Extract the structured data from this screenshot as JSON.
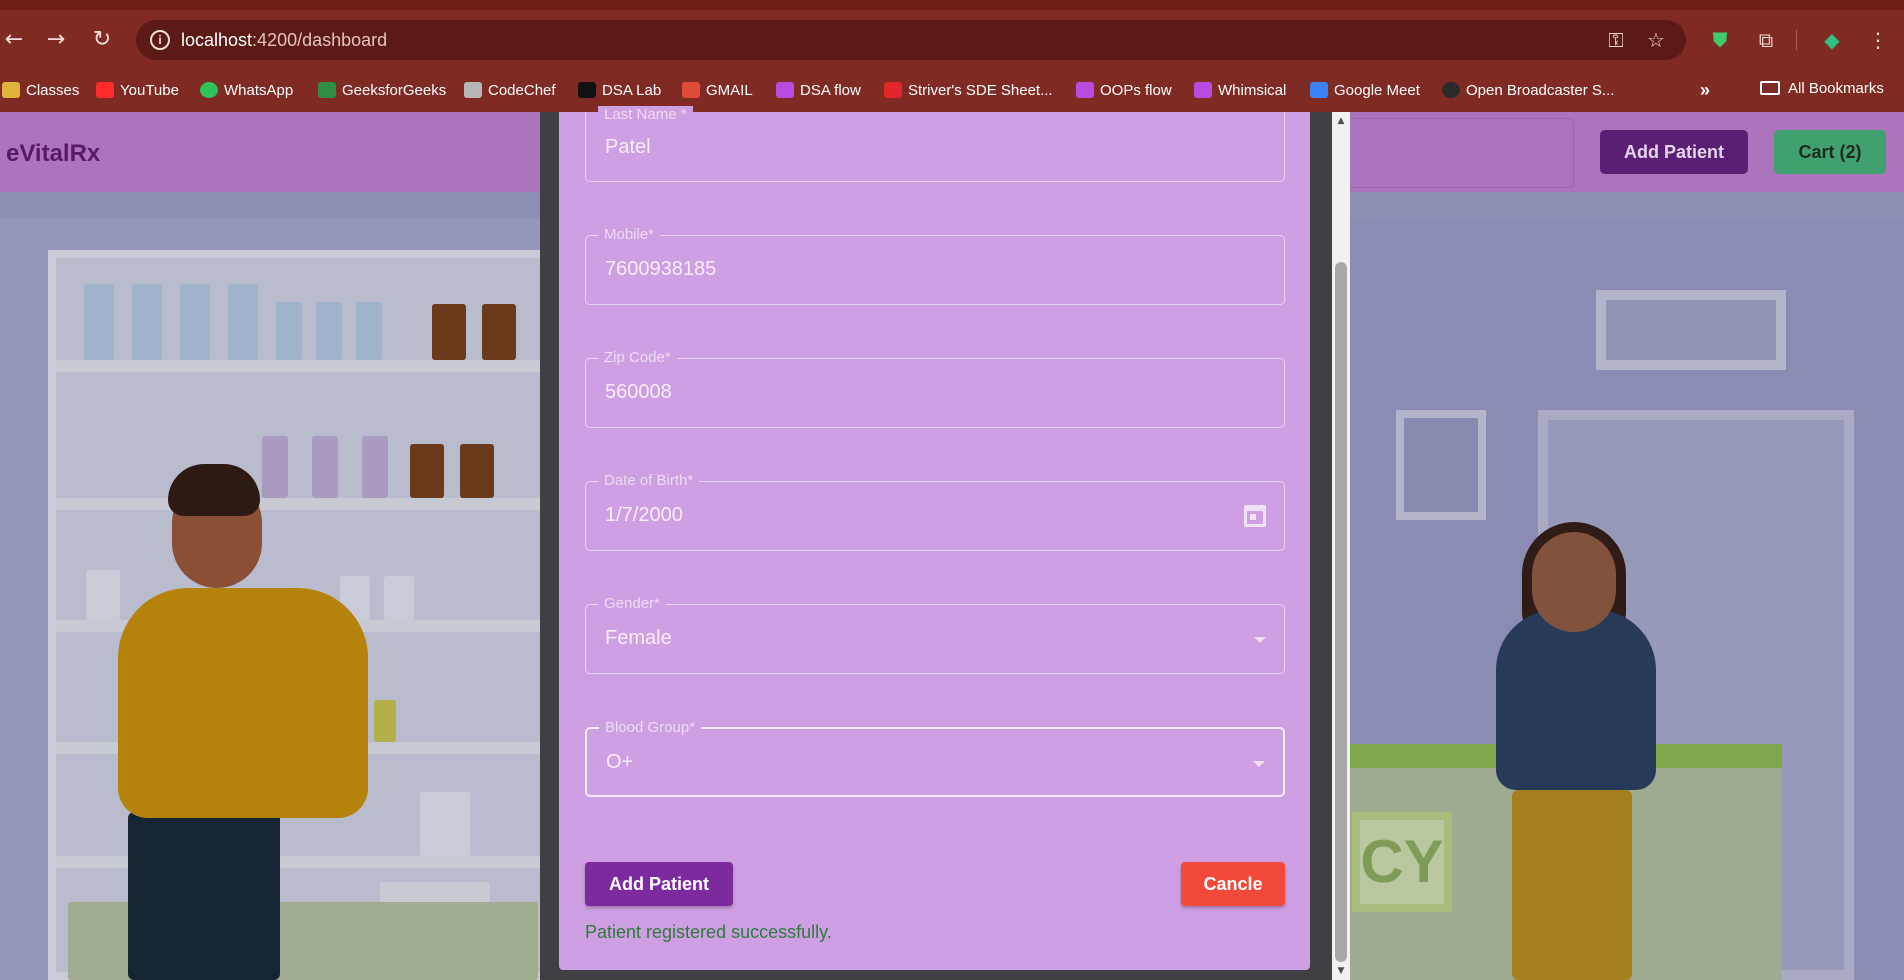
{
  "browser": {
    "url_host": "localhost",
    "url_path": ":4200/dashboard",
    "bookmarks": [
      {
        "label": "Classes",
        "color": "#e0b43a"
      },
      {
        "label": "YouTube",
        "color": "#ff2a2a"
      },
      {
        "label": "WhatsApp",
        "color": "#30c25a"
      },
      {
        "label": "GeeksforGeeks",
        "color": "#2f8d46"
      },
      {
        "label": "CodeChef",
        "color": "#b7b7b7"
      },
      {
        "label": "DSA Lab",
        "color": "#111111"
      },
      {
        "label": "GMAIL",
        "color": "#e04b3b"
      },
      {
        "label": "DSA flow",
        "color": "#b94be0"
      },
      {
        "label": "Striver's SDE Sheet...",
        "color": "#e3262b"
      },
      {
        "label": "OOPs flow",
        "color": "#b94be0"
      },
      {
        "label": "Whimsical",
        "color": "#b94be0"
      },
      {
        "label": "Google Meet",
        "color": "#3b82f6"
      },
      {
        "label": "Open Broadcaster S...",
        "color": "#2a2a2a"
      }
    ],
    "more": "»",
    "all_bookmarks": "All Bookmarks"
  },
  "app": {
    "brand": "eVitalRx",
    "add_patient": "Add Patient",
    "cart": "Cart (2)"
  },
  "form": {
    "last_name": {
      "label": "Last Name *",
      "value": "Patel"
    },
    "mobile": {
      "label": "Mobile*",
      "value": "7600938185"
    },
    "zip": {
      "label": "Zip Code*",
      "value": "560008"
    },
    "dob": {
      "label": "Date of Birth*",
      "value": "1/7/2000"
    },
    "gender": {
      "label": "Gender*",
      "value": "Female"
    },
    "blood": {
      "label": "Blood Group*",
      "value": "O+"
    },
    "submit": "Add Patient",
    "cancel": "Cancle",
    "success": "Patient registered successfully."
  }
}
